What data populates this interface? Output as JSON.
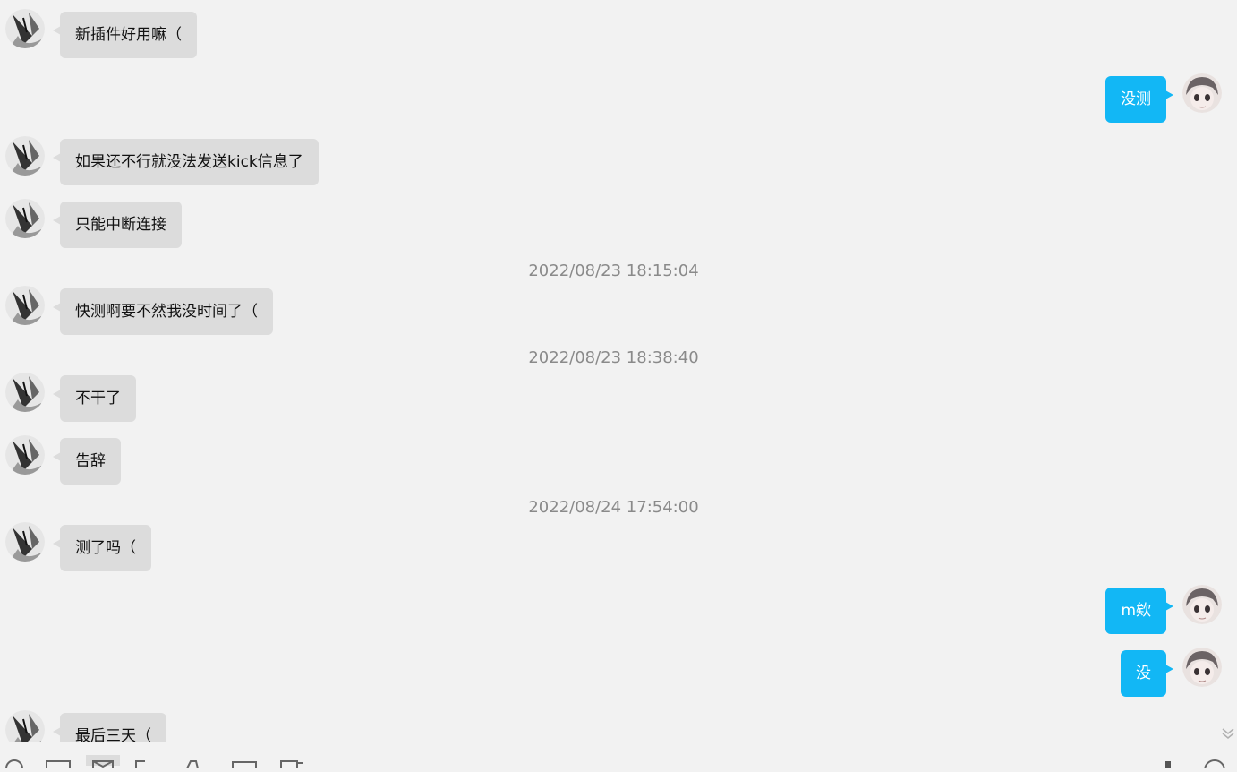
{
  "colors": {
    "background": "#f2f2f2",
    "incoming_bubble": "#dcdcdc",
    "outgoing_bubble": "#12b7f5",
    "timestamp_text": "#8a8a8a"
  },
  "messages": [
    {
      "side": "left",
      "text": "新插件好用嘛（"
    },
    {
      "side": "right",
      "text": "没测"
    },
    {
      "side": "left",
      "text": "如果还不行就没法发送kick信息了"
    },
    {
      "side": "left",
      "text": "只能中断连接"
    },
    {
      "timestamp": "2022/08/23 18:15:04"
    },
    {
      "side": "left",
      "text": "快测啊要不然我没时间了（"
    },
    {
      "timestamp": "2022/08/23 18:38:40"
    },
    {
      "side": "left",
      "text": "不干了"
    },
    {
      "side": "left",
      "text": "告辞"
    },
    {
      "timestamp": "2022/08/24 17:54:00"
    },
    {
      "side": "left",
      "text": "测了吗（"
    },
    {
      "side": "right",
      "text": "m欸"
    },
    {
      "side": "right",
      "text": "没"
    },
    {
      "side": "left",
      "text": "最后三天（"
    }
  ],
  "toolbar": {
    "icons": [
      "emoji-icon",
      "screenshot-icon",
      "image-icon",
      "file-icon",
      "shake-icon",
      "gift-icon",
      "history-icon",
      "mic-icon",
      "more-icon"
    ]
  },
  "scroll_to_bottom_icon": "double-chevron-down-icon"
}
